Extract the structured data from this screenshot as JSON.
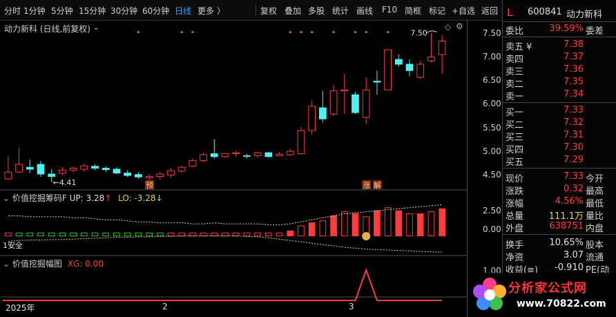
{
  "toolbar": {
    "periods": [
      "分时",
      "1分钟",
      "5分钟",
      "15分钟",
      "30分钟",
      "60分钟",
      "日线",
      "更多 〉"
    ],
    "active_period": "日线",
    "tools": [
      "复权",
      "叠加",
      "多股",
      "统计",
      "画线",
      "F10",
      "简框",
      "标记",
      "+自选",
      "返回"
    ]
  },
  "chart_header": {
    "title": "动力新科 (日线,前复权)"
  },
  "chart_data": [
    {
      "type": "candlestick",
      "y_ticks": [
        "7.50",
        "7.00",
        "6.50",
        "6.00",
        "5.50",
        "5.00",
        "4.50"
      ],
      "ylim": [
        4.28,
        7.75
      ],
      "annotations": {
        "low_label": "←4.41",
        "high_label": "7.50",
        "badge_1": "预",
        "badge_2": "涨",
        "badge_3": "解"
      },
      "candles": [
        {
          "o": 4.48,
          "c": 4.62,
          "h": 4.95,
          "l": 4.46
        },
        {
          "o": 4.62,
          "c": 4.78,
          "h": 5.12,
          "l": 4.6
        },
        {
          "o": 4.72,
          "c": 4.68,
          "h": 4.88,
          "l": 4.6
        },
        {
          "o": 4.78,
          "c": 4.58,
          "h": 4.85,
          "l": 4.52
        },
        {
          "o": 4.58,
          "c": 4.53,
          "h": 4.68,
          "l": 4.41
        },
        {
          "o": 4.6,
          "c": 4.66,
          "h": 4.72,
          "l": 4.56
        },
        {
          "o": 4.66,
          "c": 4.7,
          "h": 4.74,
          "l": 4.62
        },
        {
          "o": 4.68,
          "c": 4.75,
          "h": 4.8,
          "l": 4.62
        },
        {
          "o": 4.74,
          "c": 4.7,
          "h": 4.78,
          "l": 4.66
        },
        {
          "o": 4.7,
          "c": 4.67,
          "h": 4.74,
          "l": 4.62
        },
        {
          "o": 4.68,
          "c": 4.6,
          "h": 4.72,
          "l": 4.58
        },
        {
          "o": 4.6,
          "c": 4.55,
          "h": 4.66,
          "l": 4.52
        },
        {
          "o": 4.57,
          "c": 4.52,
          "h": 4.62,
          "l": 4.48
        },
        {
          "o": 4.5,
          "c": 4.53,
          "h": 4.58,
          "l": 4.46
        },
        {
          "o": 4.53,
          "c": 4.58,
          "h": 4.62,
          "l": 4.46
        },
        {
          "o": 4.56,
          "c": 4.65,
          "h": 4.7,
          "l": 4.5
        },
        {
          "o": 4.64,
          "c": 4.72,
          "h": 4.76,
          "l": 4.6
        },
        {
          "o": 4.74,
          "c": 4.86,
          "h": 4.9,
          "l": 4.72
        },
        {
          "o": 4.86,
          "c": 4.98,
          "h": 5.02,
          "l": 4.82
        },
        {
          "o": 5.0,
          "c": 4.94,
          "h": 5.3,
          "l": 4.9
        },
        {
          "o": 4.94,
          "c": 5.0,
          "h": 5.02,
          "l": 4.92
        },
        {
          "o": 5.0,
          "c": 5.02,
          "h": 5.06,
          "l": 4.94
        },
        {
          "o": 4.96,
          "c": 4.95,
          "h": 5.0,
          "l": 4.9
        },
        {
          "o": 4.96,
          "c": 5.02,
          "h": 5.04,
          "l": 4.92
        },
        {
          "o": 5.02,
          "c": 4.94,
          "h": 5.04,
          "l": 4.92
        },
        {
          "o": 4.96,
          "c": 4.99,
          "h": 5.03,
          "l": 4.95
        },
        {
          "o": 4.98,
          "c": 5.05,
          "h": 5.1,
          "l": 4.95
        },
        {
          "o": 5.0,
          "c": 5.48,
          "h": 5.55,
          "l": 4.98
        },
        {
          "o": 5.48,
          "c": 5.98,
          "h": 6.1,
          "l": 5.4
        },
        {
          "o": 5.95,
          "c": 5.72,
          "h": 6.3,
          "l": 5.65
        },
        {
          "o": 5.82,
          "c": 6.3,
          "h": 6.42,
          "l": 5.78
        },
        {
          "o": 6.3,
          "c": 6.32,
          "h": 6.65,
          "l": 5.82
        },
        {
          "o": 6.22,
          "c": 5.85,
          "h": 6.28,
          "l": 5.82
        },
        {
          "o": 5.75,
          "c": 6.32,
          "h": 6.58,
          "l": 5.62
        },
        {
          "o": 6.5,
          "c": 6.48,
          "h": 6.72,
          "l": 6.22
        },
        {
          "o": 6.32,
          "c": 7.15,
          "h": 7.15,
          "l": 6.32
        },
        {
          "o": 6.95,
          "c": 6.85,
          "h": 7.05,
          "l": 6.8
        },
        {
          "o": 6.85,
          "c": 6.72,
          "h": 6.95,
          "l": 6.6
        },
        {
          "o": 6.58,
          "c": 6.85,
          "h": 6.92,
          "l": 6.55
        },
        {
          "o": 6.92,
          "c": 7.0,
          "h": 7.5,
          "l": 6.88
        },
        {
          "o": 7.05,
          "c": 7.33,
          "h": 7.45,
          "l": 6.65
        }
      ]
    },
    {
      "type": "bar",
      "name_label": "价值挖掘筹码F",
      "up_label": "UP: 3.28",
      "lo_label": "LO: -3.28",
      "safe_label": "1安全",
      "y_ticks": [
        "2.50",
        "0.00"
      ],
      "ylim": [
        -1.6,
        3.4
      ],
      "values": [
        0.3,
        0.3,
        0.3,
        0.3,
        0.3,
        0.3,
        0.3,
        0.3,
        0.3,
        0.3,
        0.3,
        0.3,
        0.3,
        0.3,
        0.3,
        0.3,
        0.3,
        0.3,
        0.3,
        0.3,
        0.3,
        0.3,
        0.3,
        0.3,
        0.3,
        0.3,
        0.5,
        1.0,
        1.3,
        1.5,
        2.0,
        2.4,
        2.2,
        1.9,
        2.5,
        2.8,
        2.5,
        2.2,
        2.2,
        2.4,
        2.7
      ],
      "green": [
        0,
        1,
        1,
        1,
        1,
        1,
        1,
        1,
        1,
        1,
        1,
        1,
        1,
        1,
        1,
        0,
        0,
        0,
        0,
        0,
        0,
        0,
        0,
        0,
        0,
        0,
        0,
        0,
        0,
        0,
        0,
        0,
        0,
        0,
        0,
        0,
        0,
        0,
        0,
        0,
        0
      ],
      "upper_band": [
        2.0,
        2.0,
        1.9,
        1.9,
        1.9,
        1.9,
        1.8,
        1.8,
        1.7,
        1.6,
        1.6,
        1.5,
        1.4,
        1.4,
        1.3,
        1.3,
        1.3,
        1.2,
        1.2,
        1.3,
        1.2,
        1.2,
        1.2,
        1.2,
        1.1,
        1.1,
        1.2,
        1.4,
        1.6,
        1.8,
        2.0,
        2.2,
        2.3,
        2.4,
        2.5,
        2.6,
        2.7,
        2.8,
        2.9,
        3.0,
        3.1
      ],
      "lower_band": [
        -1.2,
        -1.0,
        -0.9,
        -0.9,
        -0.8,
        -0.8,
        -0.7,
        -0.6,
        -0.5,
        -0.4,
        -0.3,
        -0.3,
        -0.2,
        -0.2,
        -0.1,
        -0.1,
        0.0,
        0.0,
        0.0,
        0.0,
        0.0,
        0.0,
        -0.1,
        -0.2,
        -0.4,
        -0.7,
        -1.0,
        -1.3,
        -1.6,
        -1.9,
        -2.2,
        -2.5,
        -2.7,
        -2.9,
        -3.0,
        -3.1,
        -3.2,
        -3.3,
        -3.4,
        -3.5,
        -3.6
      ]
    },
    {
      "type": "line",
      "name_label": "价值挖掘幅图",
      "xg_label": "XG: 0.00",
      "y_ticks": [
        "1.00",
        "0.00"
      ],
      "ylim": [
        0,
        1.25
      ],
      "values": [
        0,
        0,
        0,
        0,
        0,
        0,
        0,
        0,
        0,
        0,
        0,
        0,
        0,
        0,
        0,
        0,
        0,
        0,
        0,
        0,
        0,
        0,
        0,
        0,
        0,
        0,
        0,
        0,
        0,
        0,
        0,
        0,
        0,
        1,
        0,
        0,
        0,
        0,
        0,
        0,
        0
      ],
      "x_labels": [
        "2025年",
        "2",
        "3"
      ],
      "x_label_index": [
        0,
        15,
        33
      ]
    }
  ],
  "quote": {
    "flag": "L",
    "code": "600841",
    "name": "动力新科",
    "webi_label": "委比",
    "webi_value": "39.59%",
    "wecha_label": "委差",
    "asks": [
      {
        "label": "卖五 ¥",
        "price": "7.38"
      },
      {
        "label": "卖四",
        "price": "7.37"
      },
      {
        "label": "卖三",
        "price": "7.36"
      },
      {
        "label": "卖二",
        "price": "7.35"
      },
      {
        "label": "卖一",
        "price": "7.34"
      }
    ],
    "bids": [
      {
        "label": "买一",
        "price": "7.33"
      },
      {
        "label": "买二",
        "price": "7.32"
      },
      {
        "label": "买三",
        "price": "7.31"
      },
      {
        "label": "买四",
        "price": "7.30"
      },
      {
        "label": "买五",
        "price": "7.29"
      }
    ],
    "stats": [
      {
        "label": "现价",
        "value": "7.33",
        "label2": "今开",
        "color": "red"
      },
      {
        "label": "涨跌",
        "value": "0.32",
        "label2": "最高",
        "color": "red"
      },
      {
        "label": "涨幅",
        "value": "4.56%",
        "label2": "最低",
        "color": "red"
      },
      {
        "label": "总量",
        "value": "111.1万",
        "label2": "量比",
        "color": "yellow"
      },
      {
        "label": "外盘",
        "value": "638751",
        "label2": "内盘",
        "color": "red"
      }
    ],
    "fundamentals": [
      {
        "label": "换手",
        "value": "10.65%",
        "label2": "股本"
      },
      {
        "label": "净资",
        "value": "3.07",
        "label2": "流通"
      },
      {
        "label": "收益(≡)",
        "value": "-0.910",
        "label2": "PE(动"
      }
    ]
  },
  "watermark": {
    "title": "分析家公式网",
    "url": "www.70822.com"
  },
  "colors": {
    "up": "#ff3b3b",
    "down": "#4ef0f0",
    "green_bar": "#22cc22",
    "active": "#3aa0ff",
    "dot": "#cc44cc",
    "band": "#e8e060"
  }
}
